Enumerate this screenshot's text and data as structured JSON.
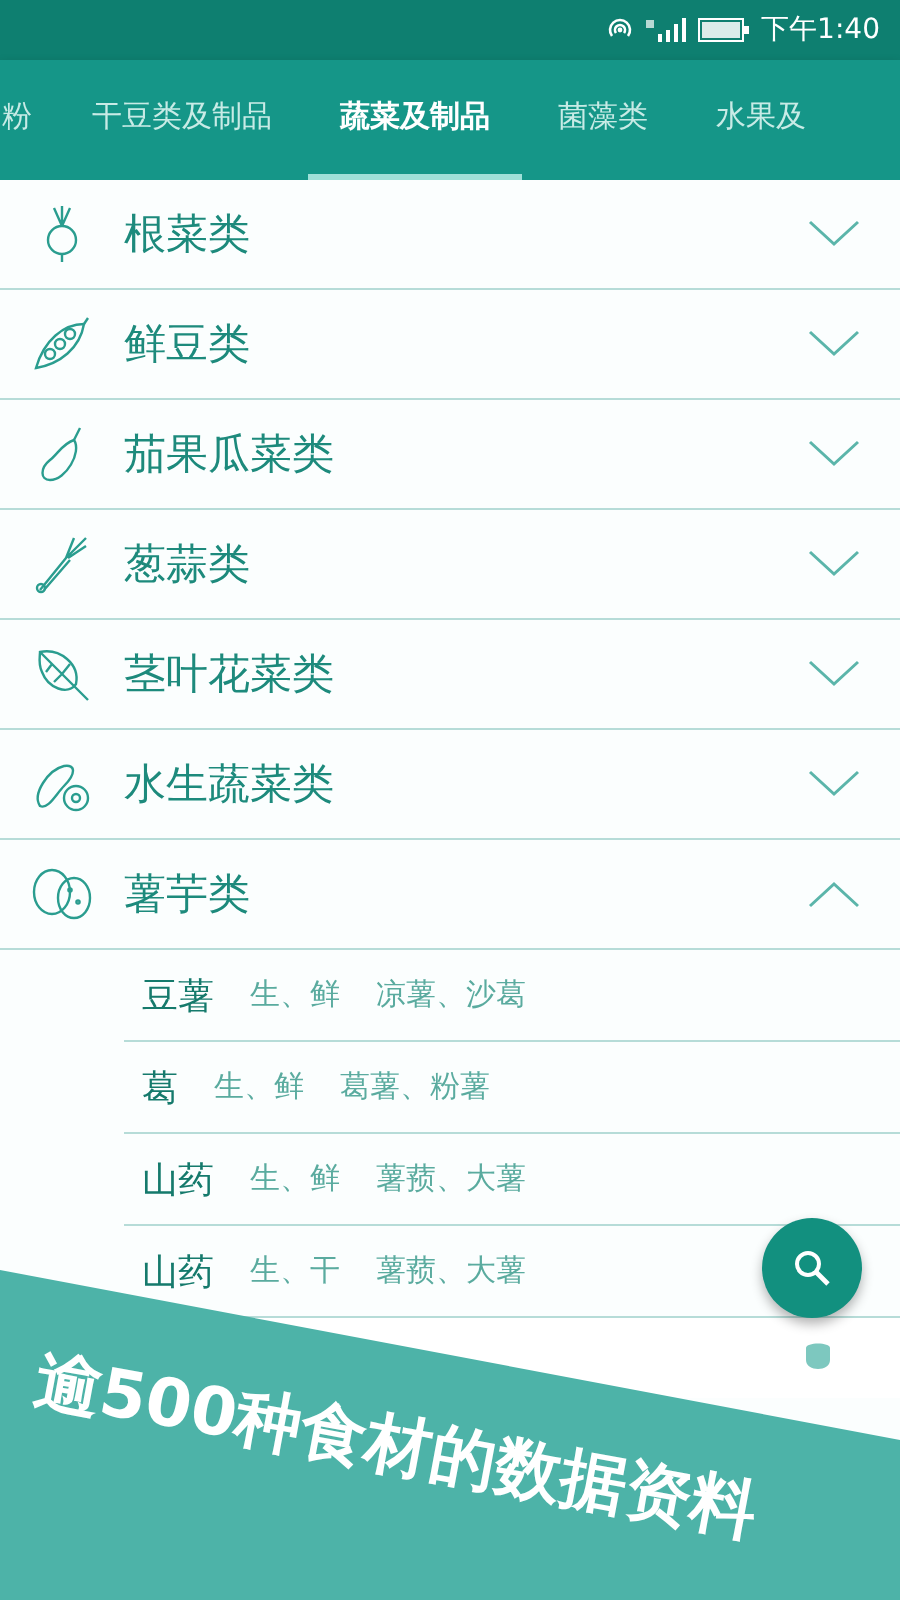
{
  "status_bar": {
    "time": "下午1:40"
  },
  "tabs": [
    {
      "label": "粉",
      "selected": false
    },
    {
      "label": "干豆类及制品",
      "selected": false
    },
    {
      "label": "蔬菜及制品",
      "selected": true
    },
    {
      "label": "菌藻类",
      "selected": false
    },
    {
      "label": "水果及",
      "selected": false
    }
  ],
  "categories": [
    {
      "name": "根菜类",
      "expanded": false
    },
    {
      "name": "鲜豆类",
      "expanded": false
    },
    {
      "name": "茄果瓜菜类",
      "expanded": false
    },
    {
      "name": "葱蒜类",
      "expanded": false
    },
    {
      "name": "茎叶花菜类",
      "expanded": false
    },
    {
      "name": "水生蔬菜类",
      "expanded": false
    },
    {
      "name": "薯芋类",
      "expanded": true,
      "children": [
        {
          "name": "豆薯",
          "state": "生、鲜",
          "alias": "凉薯、沙葛"
        },
        {
          "name": "葛",
          "state": "生、鲜",
          "alias": "葛薯、粉薯"
        },
        {
          "name": "山药",
          "state": "生、鲜",
          "alias": "薯蓣、大薯"
        },
        {
          "name": "山药",
          "state": "生、干",
          "alias": "薯蓣、大薯"
        }
      ]
    }
  ],
  "banner": {
    "text": "逾500种食材的数据资料"
  }
}
